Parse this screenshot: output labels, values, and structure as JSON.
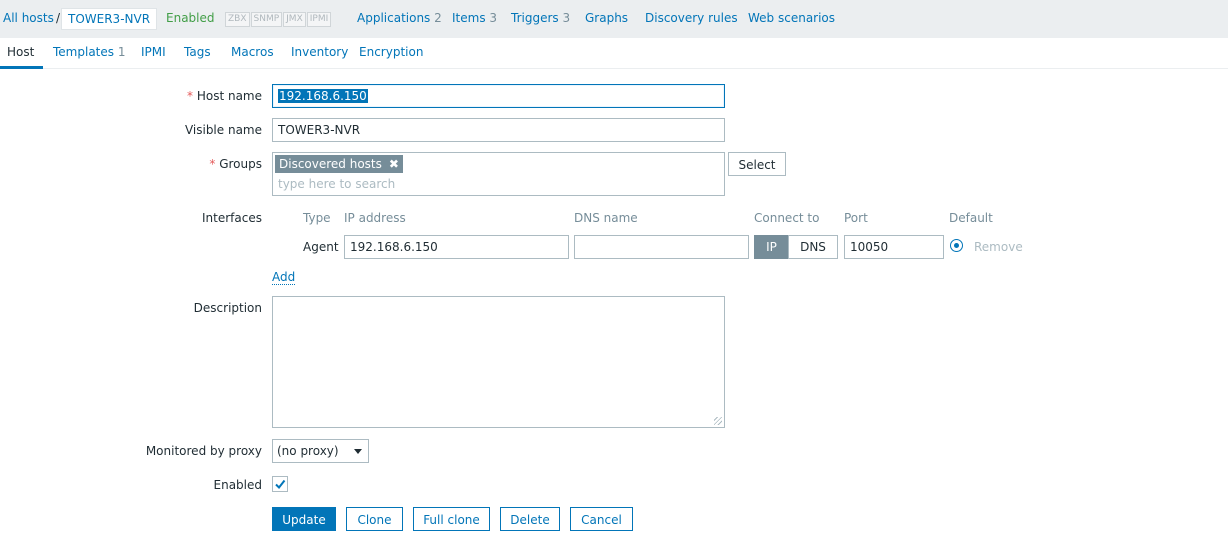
{
  "nav": {
    "all_hosts": "All hosts",
    "separator": "/",
    "host": "TOWER3-NVR",
    "status": "Enabled",
    "availability": [
      "ZBX",
      "SNMP",
      "JMX",
      "IPMI"
    ],
    "links": [
      {
        "label": "Applications",
        "count": "2"
      },
      {
        "label": "Items",
        "count": "3"
      },
      {
        "label": "Triggers",
        "count": "3"
      },
      {
        "label": "Graphs",
        "count": ""
      },
      {
        "label": "Discovery rules",
        "count": ""
      },
      {
        "label": "Web scenarios",
        "count": ""
      }
    ]
  },
  "tabs": [
    {
      "label": "Host",
      "count": ""
    },
    {
      "label": "Templates",
      "count": "1"
    },
    {
      "label": "IPMI",
      "count": ""
    },
    {
      "label": "Tags",
      "count": ""
    },
    {
      "label": "Macros",
      "count": ""
    },
    {
      "label": "Inventory",
      "count": ""
    },
    {
      "label": "Encryption",
      "count": ""
    }
  ],
  "form": {
    "required_mark": "*",
    "host_name_label": "Host name",
    "host_name_value": "192.168.6.150",
    "visible_name_label": "Visible name",
    "visible_name_value": "TOWER3-NVR",
    "groups_label": "Groups",
    "group_chip": "Discovered hosts",
    "groups_placeholder": "type here to search",
    "select_button": "Select",
    "interfaces_label": "Interfaces",
    "interface_headers": {
      "type": "Type",
      "ip": "IP address",
      "dns": "DNS name",
      "connect": "Connect to",
      "port": "Port",
      "default": "Default"
    },
    "interface_row": {
      "type": "Agent",
      "ip": "192.168.6.150",
      "dns": "",
      "connect_ip": "IP",
      "connect_dns": "DNS",
      "port": "10050",
      "remove": "Remove"
    },
    "add_link": "Add",
    "description_label": "Description",
    "proxy_label": "Monitored by proxy",
    "proxy_value": "(no proxy)",
    "enabled_label": "Enabled",
    "enabled_checked": true
  },
  "buttons": {
    "update": "Update",
    "clone": "Clone",
    "full_clone": "Full clone",
    "delete": "Delete",
    "cancel": "Cancel"
  },
  "colors": {
    "accent": "#0275b8",
    "status_enabled": "#429e47",
    "required": "#e45959"
  }
}
